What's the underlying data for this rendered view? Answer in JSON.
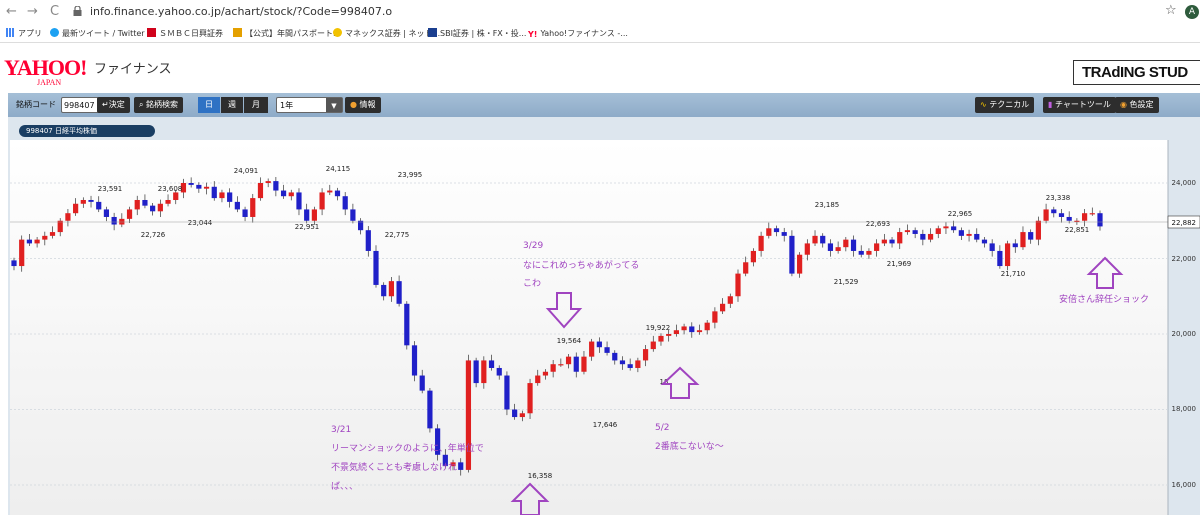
{
  "browser": {
    "nav_back": "←",
    "nav_forward": "→",
    "reload": "C",
    "url": "info.finance.yahoo.co.jp/achart/stock/?Code=998407.o",
    "avatar_letter": "A"
  },
  "bookmarks": [
    {
      "label": "アプリ",
      "color": "#4285f4"
    },
    {
      "label": "最新ツイート / Twitter",
      "color": "#1da1f2"
    },
    {
      "label": "ＳＭＢＣ日興証券",
      "color": "#d0021b"
    },
    {
      "label": "【公式】年間パスポート...",
      "color": "#e4a000"
    },
    {
      "label": "マネックス証券 | ネット...",
      "color": "#222222"
    },
    {
      "label": "SBI証券 | 株・FX・投...",
      "color": "#1b3f8f"
    },
    {
      "label": "Yahoo!ファイナンス -...",
      "color": "#ff0033"
    }
  ],
  "header": {
    "logo": "YAHOO!",
    "logo_sub": "JAPAN",
    "section": "ファイナンス",
    "trading_studio": "TRAdING STUD"
  },
  "toolbar": {
    "code_label": "銘柄コード",
    "code_value": "998407",
    "decide": "↵決定",
    "search": "銘柄検索",
    "tabs": [
      "日",
      "週",
      "月"
    ],
    "active_tab": "日",
    "period": "1年",
    "info": "情報",
    "technical": "テクニカル",
    "chart_tool": "チャートツール",
    "color_settings": "色設定"
  },
  "chart_label": "998407 日経平均株価",
  "chart_data": {
    "type": "candlestick",
    "y_ticks": [
      "24,000",
      "22,000",
      "20,000",
      "18,000",
      "16,000"
    ],
    "current_price": "22,882",
    "price_labels": [
      "23,591",
      "23,608",
      "22,726",
      "23,044",
      "24,091",
      "24,115",
      "22,951",
      "23,995",
      "22,775",
      "19,564",
      "17,646",
      "16,358",
      "19,922",
      "18",
      "23,185",
      "22,693",
      "21,529",
      "21,969",
      "22,965",
      "21,710",
      "23,338",
      "22,851"
    ],
    "closes": [
      21800,
      22500,
      22400,
      22500,
      22600,
      22700,
      23000,
      23200,
      23450,
      23550,
      23500,
      23300,
      23100,
      22900,
      23050,
      23300,
      23550,
      23400,
      23250,
      23450,
      23550,
      23750,
      24000,
      23950,
      23850,
      23900,
      23600,
      23750,
      23500,
      23300,
      23100,
      23600,
      24000,
      24050,
      23800,
      23650,
      23750,
      23300,
      23000,
      23300,
      23750,
      23800,
      23650,
      23300,
      23000,
      22750,
      22200,
      21300,
      21000,
      21400,
      20800,
      19700,
      18900,
      18500,
      17500,
      16800,
      16500,
      16600,
      16400,
      19300,
      18700,
      19300,
      19100,
      18900,
      18000,
      17800,
      17900,
      18700,
      18900,
      19000,
      19200,
      19200,
      19400,
      19000,
      19400,
      19800,
      19650,
      19500,
      19300,
      19200,
      19100,
      19300,
      19600,
      19800,
      19950,
      20000,
      20100,
      20200,
      20050,
      20100,
      20300,
      20600,
      20800,
      21000,
      21600,
      21900,
      22200,
      22600,
      22800,
      22700,
      22600,
      21600,
      22100,
      22400,
      22600,
      22400,
      22200,
      22300,
      22500,
      22200,
      22100,
      22200,
      22400,
      22500,
      22400,
      22700,
      22750,
      22650,
      22500,
      22650,
      22800,
      22850,
      22750,
      22600,
      22650,
      22500,
      22400,
      22200,
      21800,
      22400,
      22300,
      22700,
      22500,
      23000,
      23300,
      23200,
      23100,
      23000,
      23000,
      23200,
      23200,
      22850
    ]
  },
  "annotations": {
    "a329_date": "3/29",
    "a329_text1": "なにこれめっちゃあがってる",
    "a329_text2": "こわ",
    "a321_date": "3/21",
    "a321_text1": "リーマンショックのように、年単位で",
    "a321_text2": "不景気続くことも考慮しなけれ",
    "a321_text3": "ば、、、",
    "a52_date": "5/2",
    "a52_text": "2番底こないな～",
    "abe_text": "安倍さん辞任ショック"
  },
  "colors": {
    "up": "#e02020",
    "down": "#2020c8",
    "annotation": "#a044c0",
    "chart_bg": "#dde6ee",
    "toolbar": "#9bb6d0"
  }
}
